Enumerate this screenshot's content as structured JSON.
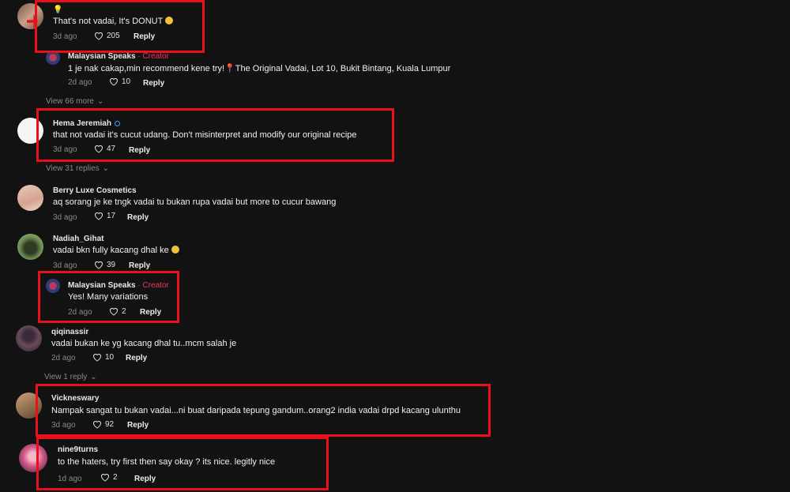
{
  "comments": [
    {
      "user": "",
      "text": "That's not vadai, It's DONUT",
      "emoji_after": "crying-face-emoji",
      "time": "3d ago",
      "likes": "205",
      "reply": "Reply"
    },
    {
      "user": "Malaysian Speaks",
      "creator_tag": "· Creator",
      "text": "1 je nak cakap,min recommend kene try!📍The Original Vadai, Lot 10, Bukit Bintang, Kuala Lumpur",
      "time": "2d ago",
      "likes": "10",
      "reply": "Reply"
    },
    {
      "user": "Hema Jeremiah",
      "text": "that not vadai it's cucut udang. Don't misinterpret and modify our original recipe",
      "time": "3d ago",
      "likes": "47",
      "reply": "Reply"
    },
    {
      "user": "Berry Luxe Cosmetics",
      "text": "aq sorang je ke tngk vadai tu bukan rupa vadai but more to cucur bawang",
      "time": "3d ago",
      "likes": "17",
      "reply": "Reply"
    },
    {
      "user": "Nadiah_Gihat",
      "text": "vadai bkn fully kacang dhal ke",
      "emoji_after": "thinking-face-emoji",
      "time": "3d ago",
      "likes": "39",
      "reply": "Reply"
    },
    {
      "user": "Malaysian Speaks",
      "creator_tag": "· Creator",
      "text": "Yes! Many variations",
      "time": "2d ago",
      "likes": "2",
      "reply": "Reply"
    },
    {
      "user": "qiqinassir",
      "text": "vadai bukan ke yg kacang dhal tu..mcm salah je",
      "time": "2d ago",
      "likes": "10",
      "reply": "Reply"
    },
    {
      "user": "Vickneswary",
      "text": "Nampak sangat tu bukan vadai...ni buat daripada tepung gandum..orang2 india vadai drpd kacang ulunthu",
      "time": "3d ago",
      "likes": "92",
      "reply": "Reply"
    },
    {
      "user": "nine9turns",
      "text": "to the haters, try first then say okay ? its nice. legitly nice",
      "time": "1d ago",
      "likes": "2",
      "reply": "Reply"
    }
  ],
  "view_more": [
    "View 66 more",
    "View 31 replies",
    "View 1 reply"
  ],
  "colors": {
    "background": "#121212",
    "highlight": "#e8101a",
    "creator": "#f2365e",
    "verified": "#3ca1ff"
  }
}
